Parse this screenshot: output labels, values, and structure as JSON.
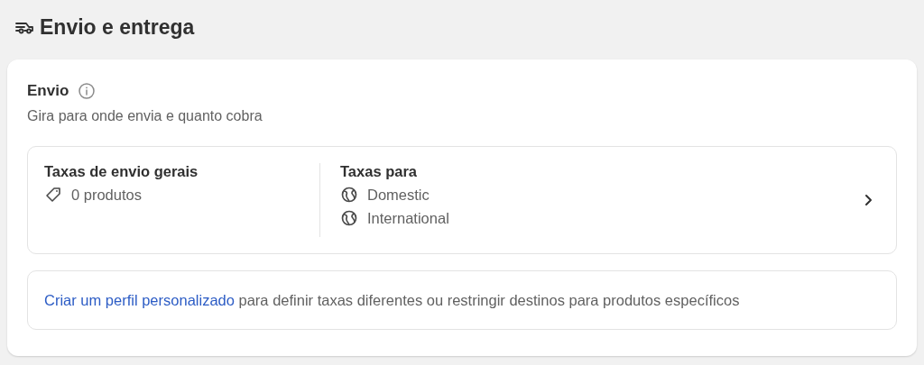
{
  "page_title": "Envio e entrega",
  "section": {
    "title": "Envio",
    "description": "Gira para onde envia e quanto cobra",
    "profile": {
      "title": "Taxas de envio gerais",
      "products": "0 produtos",
      "rates_label": "Taxas para",
      "zones": [
        {
          "name": "Domestic"
        },
        {
          "name": "International"
        }
      ]
    },
    "custom": {
      "link": "Criar um perfil personalizado",
      "text": " para definir taxas diferentes ou restringir destinos para produtos específicos"
    }
  }
}
